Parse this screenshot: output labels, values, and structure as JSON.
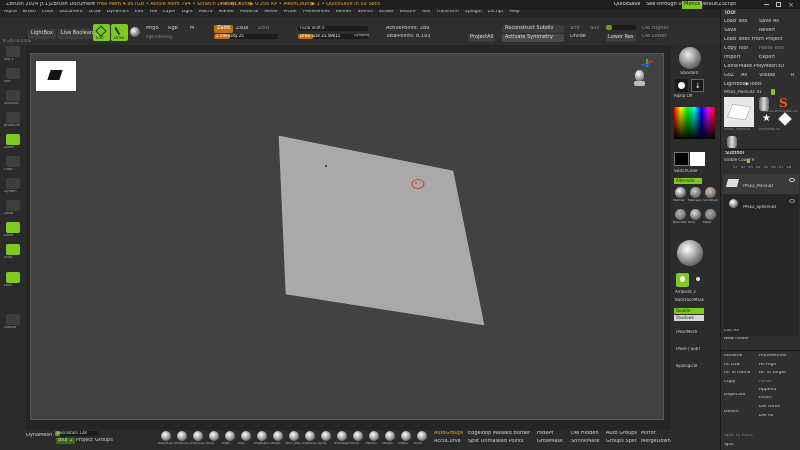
{
  "titlebar": {
    "app": "ZBrush 2024 [f.1]",
    "doc": "ZBrush Document",
    "mem": "• Free Mem 4.957GB • Active Mem 794 • Scratch Disk 40 •",
    "poly": "• PolyCount▶ 0.256 KP • MeshCount▶ 1 • QuickSave In 59 Secs",
    "quicksave": "QuickSave",
    "seethrough": "See-through  0",
    "menus_label": "Menus",
    "script": "DefaultZScript"
  },
  "menubar": [
    "Alpha",
    "Brush",
    "Color",
    "Document",
    "Draw",
    "Dynamics",
    "Edit",
    "File",
    "Layer",
    "Light",
    "Macro",
    "Marker",
    "Material",
    "Movie",
    "Picker",
    "Preferences",
    "Render",
    "Stencil",
    "Stroke",
    "Texture",
    "Tool",
    "Transform",
    "Zplugin",
    "Zscript",
    "Help"
  ],
  "status_left": "IC-ZS:-0.3TILE",
  "toptools": {
    "lightbox": "LightBox",
    "livebool": "Live Boolean",
    "edit": "Edit",
    "draw": "Draw",
    "mrgb": "Mrgb",
    "rgb": "Rgb",
    "m": "M",
    "rgb_intensity": "Rgb Intensity",
    "zadd": "Zadd",
    "zsub": "Zsub",
    "zcut": "Zcut",
    "zintensity": "Z Intensity 25",
    "focal": "Focal Shift 0",
    "drawsize": "Draw Size 21.59011",
    "dynamic": "Dynamic",
    "activepoints": "ActivePoints: 289",
    "totalpoints": "TotalPoints: 8,193",
    "projectall": "ProjectAll",
    "reconstruct": "Reconstruct Subdiv",
    "actsym": "Activate Symmetry",
    "divide": "Divide",
    "smt": "Smt",
    "suv": "Suv",
    "zremesher": "ZRemesher",
    "polypaint": "Polypaint",
    "undo": "Undo",
    "redo": "Redo",
    "bpr": "BPR",
    "spix": "SPix 3",
    "persp": "Persp",
    "floor": "Floor",
    "lsym": "L.Sym",
    "xyz": "Xyz",
    "qviz": "QViz",
    "mrgbv": "Mrgb",
    "mesh": "Mesh",
    "pol": "PolyF",
    "transp": "Transp",
    "ghost": "Ghost",
    "solo": "Solo",
    "xpose": "Xpose",
    "sdiv": "SDiv 1",
    "lower": "Lower Res",
    "higher": "Higher Res",
    "del_lower": "Del Lower",
    "del_higher": "Del Higher",
    "dyn_subdiv": "Dynamic Subdiv",
    "smooth": "Smooth",
    "gkey": "Gkey",
    "pin": "Pin",
    "frame": "Frame",
    "move": "Move",
    "scale": "Scale",
    "rotate": "Rotate",
    "line_fill": "Line Fill",
    "lfill": "PolyF",
    "xpose2": "Xpose"
  },
  "left_tools": [
    "Sky 3",
    "Seit",
    "SculptUI",
    "BrushCtrl",
    "Zoom",
    "Grab",
    "Dynam",
    "Local",
    "Draw",
    "Strip",
    "Lock",
    "Groups"
  ],
  "dynamesh": {
    "label": "DynaMesh",
    "resolution": "Resolution 128",
    "blur": "Blur 2",
    "project": "Project",
    "groups": "Groups"
  },
  "brushes": [
    "SelectLasso",
    "SliceCurve",
    "ClipCurve",
    "Move",
    "Inflat",
    "Clay",
    "ClayBuildup",
    "hPolish",
    "Dam_Standard",
    "Snakehook",
    "Spine",
    "TrimAdaptive",
    "Planar",
    "Flatten",
    "hPolish",
    "Inflate",
    "Pinch"
  ],
  "bottom_mid": {
    "auto": "AutoGroups",
    "accucurve": "AccuCurve",
    "edgeloop": "Edgeloop Masked Border",
    "split": "Split Unmasked Points",
    "hide_pt": "HidePt",
    "growmask": "GrowMask",
    "delhidden": "Del Hidden",
    "shrinkmask": "ShrinkMask",
    "autogroups": "Auto Groups",
    "groupssplit": "Groups Split",
    "mirror": "Mirror",
    "mergedown": "MergeDown"
  },
  "right_shelf": {
    "standard": "Standard",
    "alpha": "Alpha Off",
    "texture": "Texture Off",
    "gradient": "Gradient",
    "switch_color": "SwitchColor",
    "alternate": "Alternate",
    "materials": "Materials",
    "ambient": "Ambient 3",
    "backface": "BackFaceMask",
    "double": "Double",
    "shadows": "Shadows",
    "tposemesh": "TPoseMesh",
    "tposesub": "TPose | SubT",
    "topological": "Topological",
    "material_items": [
      "MatCap",
      "MatCapG",
      "SkinShade",
      "BasicMat",
      "Blinn",
      "Metal"
    ]
  },
  "tool": {
    "title": "Tool",
    "load": "Load Tool",
    "saveas": "Save As",
    "save": "Save",
    "revert": "Revert",
    "loadproject": "Load Tools From Project",
    "copy": "Copy Tool",
    "paste": "Paste Tool",
    "import": "Import",
    "export": "Export",
    "clone": "Clone",
    "make_polymesh": "Make PolyMesh3D",
    "goz": "GoZ",
    "all": "All",
    "visible": "Visible",
    "r": "R",
    "lightbox_tools": "Lightbox▶Tools",
    "current": "PM3D_Plane3D: 41",
    "current_val": "41",
    "thumbs": [
      "PM3D_Plane3D",
      "Cylinder3D",
      "PolyMesh3D",
      "SimpleBrush",
      "PM3D_Plane3D",
      "PM3D_Sphere3D"
    ],
    "subtool_title": "Subtool",
    "visible_count": "Visible Count 9",
    "subtool_cols": [
      "V1",
      "V2",
      "V3",
      "V4",
      "V5",
      "V6",
      "V7",
      "V8"
    ],
    "subtool_items": [
      "PM3D_Plane3D",
      "PM3D_Sphere3D"
    ],
    "list_all": "List All",
    "new_folder": "New Folder",
    "rename": "Rename",
    "autoreorder": "AutoReorder",
    "all_low": "All Low",
    "all_high": "All High",
    "all_to_home": "All To Home",
    "all_to_target": "All To Target",
    "copy2": "Copy",
    "paste2": "Paste",
    "duplicate": "Duplicate",
    "append": "Append",
    "insert": "Insert",
    "delete": "Delete",
    "del_other": "Del Other",
    "del_all": "Del All",
    "split": "Split",
    "split_to_parts": "Split To Parts",
    "merge": "Merge"
  }
}
